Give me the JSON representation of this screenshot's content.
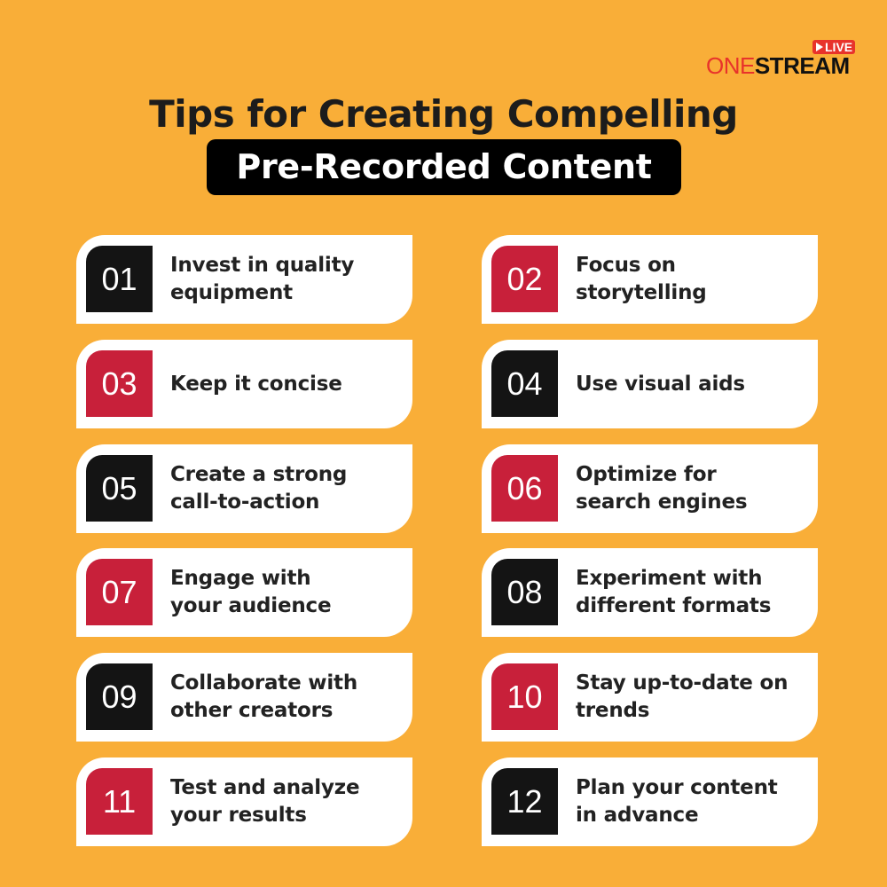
{
  "brand": {
    "live_label": "LIVE",
    "name_part1": "ONE",
    "name_part2": "STREAM",
    "accent_color": "#E8332B"
  },
  "header": {
    "title": "Tips for Creating Compelling",
    "subtitle": "Pre-Recorded Content"
  },
  "colors": {
    "background": "#F9AE38",
    "red": "#C8203A",
    "black": "#141414"
  },
  "tips": [
    {
      "number": "01",
      "text": "Invest in quality equipment",
      "color": "black"
    },
    {
      "number": "02",
      "text": "Focus on storytelling",
      "color": "red"
    },
    {
      "number": "03",
      "text": "Keep it concise",
      "color": "red"
    },
    {
      "number": "04",
      "text": "Use visual aids",
      "color": "black"
    },
    {
      "number": "05",
      "text": "Create a strong call-to-action",
      "color": "black"
    },
    {
      "number": "06",
      "text": "Optimize for search engines",
      "color": "red"
    },
    {
      "number": "07",
      "text": "Engage with your audience",
      "color": "red"
    },
    {
      "number": "08",
      "text": "Experiment with different formats",
      "color": "black"
    },
    {
      "number": "09",
      "text": "Collaborate with other creators",
      "color": "black"
    },
    {
      "number": "10",
      "text": "Stay up-to-date on trends",
      "color": "red"
    },
    {
      "number": "11",
      "text": "Test and analyze your results",
      "color": "red"
    },
    {
      "number": "12",
      "text": "Plan your content in advance",
      "color": "black"
    }
  ]
}
